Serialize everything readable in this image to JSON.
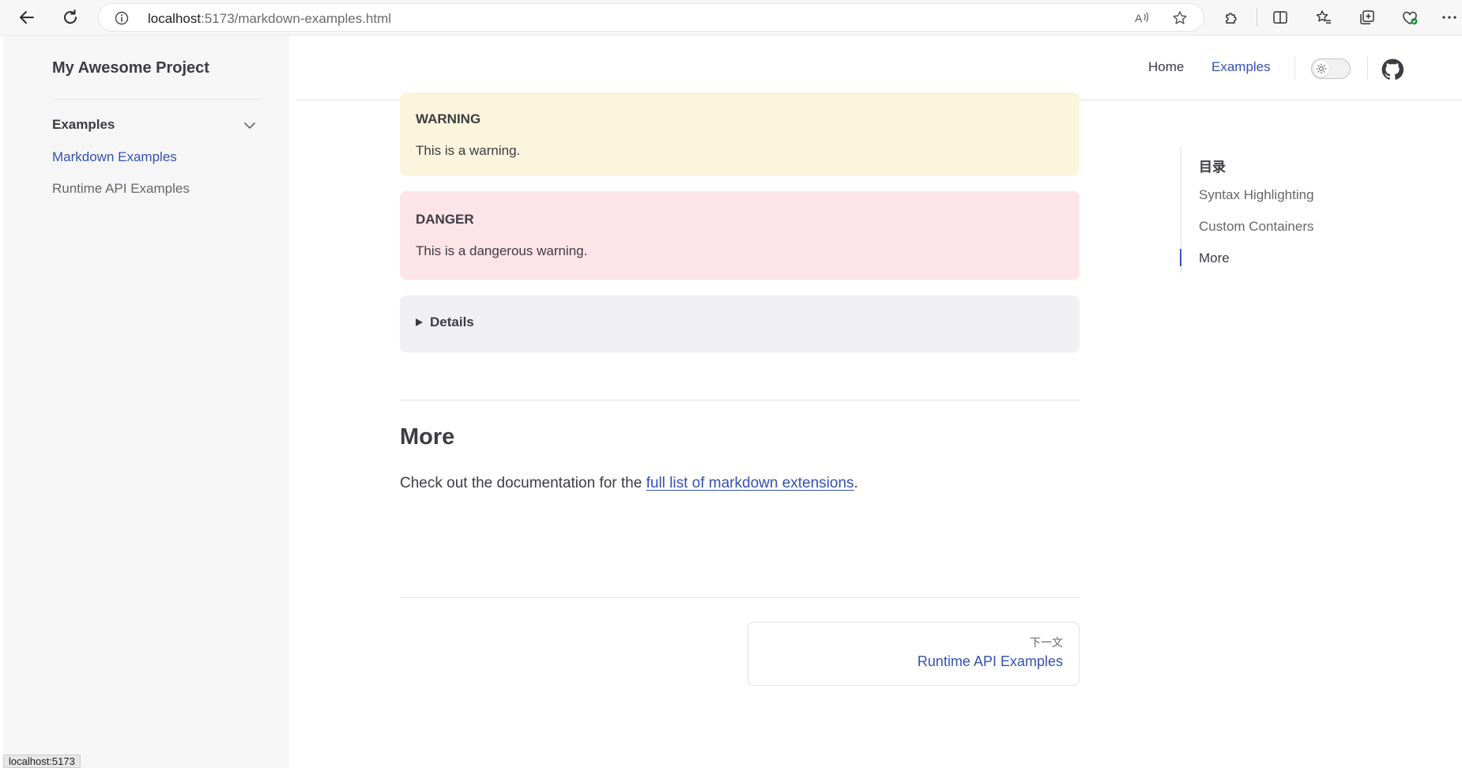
{
  "browser": {
    "url_host": "localhost",
    "url_path": ":5173/markdown-examples.html"
  },
  "sidebar": {
    "brand": "My Awesome Project",
    "group_title": "Examples",
    "items": [
      {
        "label": "Markdown Examples",
        "active": true
      },
      {
        "label": "Runtime API Examples",
        "active": false
      }
    ]
  },
  "topnav": {
    "links": [
      {
        "label": "Home",
        "active": false
      },
      {
        "label": "Examples",
        "active": true
      }
    ],
    "theme_icon": "sun-icon",
    "github_icon": "github-icon"
  },
  "content": {
    "warning": {
      "title": "WARNING",
      "text": "This is a warning."
    },
    "danger": {
      "title": "DANGER",
      "text": "This is a dangerous warning."
    },
    "details_label": "Details",
    "heading": "More",
    "paragraph_before": "Check out the documentation for the ",
    "paragraph_link": "full list of markdown extensions",
    "paragraph_after": ".",
    "next": {
      "small": "下一文",
      "title": "Runtime API Examples"
    }
  },
  "toc": {
    "title": "目录",
    "items": [
      {
        "label": "Syntax Highlighting",
        "active": false
      },
      {
        "label": "Custom Containers",
        "active": false
      },
      {
        "label": "More",
        "active": true
      }
    ]
  },
  "status_bar": "localhost:5173",
  "colors": {
    "brand": "#3451b2",
    "warning_bg": "#fbf5de",
    "danger_bg": "#fde4e8",
    "details_bg": "#f0f0f3",
    "sidebar_bg": "#f6f6f7"
  }
}
